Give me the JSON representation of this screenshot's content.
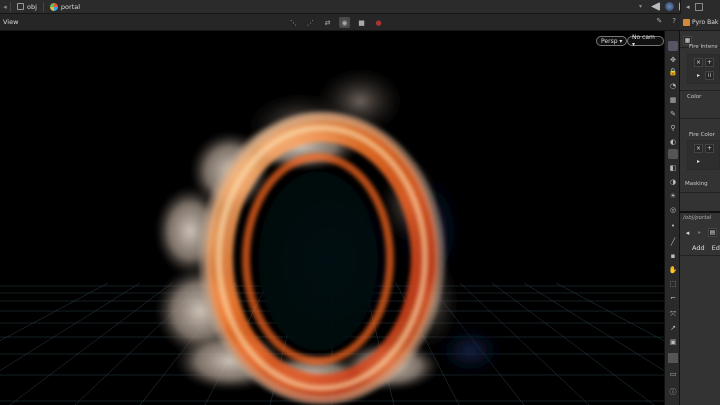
{
  "pathbar": {
    "crumbs": [
      {
        "label": "obj",
        "icon": "object-network-icon"
      },
      {
        "label": "portal",
        "icon": "geometry-node-icon"
      }
    ]
  },
  "viewport": {
    "title": "View",
    "camera_label": "Persp ▾",
    "cam_select_label": "No cam ▾",
    "colors": {
      "grid": "#3a5a6a",
      "background": "#000000"
    }
  },
  "param_panel": {
    "title": "Pyro Bak",
    "fire_intensity_label": "Fire Intens",
    "color_label": "Color",
    "fire_color_label": "Fire Color",
    "masking_label": "Masking",
    "node_path": "/obj/portal",
    "add_label": "Add",
    "edit_label": "Edi"
  }
}
